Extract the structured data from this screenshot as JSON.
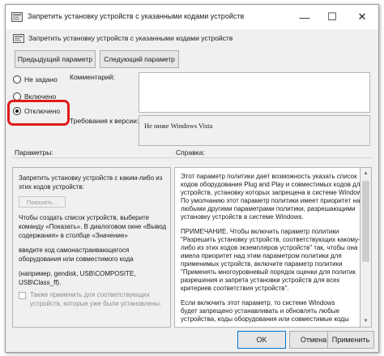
{
  "window": {
    "title": "Запретить установку устройств с указанными кодами устройств",
    "minimize": "—",
    "maximize": "☐",
    "close": "✕"
  },
  "policy": {
    "name": "Запретить установку устройств с указанными кодами устройств"
  },
  "nav": {
    "prev_label": "Предыдущий параметр",
    "next_label": "Следующий параметр"
  },
  "state": {
    "options": [
      {
        "label": "Не задано",
        "checked": false
      },
      {
        "label": "Включено",
        "checked": false
      },
      {
        "label": "Отключено",
        "checked": true
      }
    ],
    "highlight_color": "#e11b1b"
  },
  "labels": {
    "comment": "Комментарий:",
    "supported": "Требования к версии:",
    "params": "Параметры:",
    "help": "Справка:"
  },
  "supported_value": "Не ниже Windows Vista",
  "options_panel": {
    "lines": [
      "Запретить установку устройств с каким-либо из",
      "этих кодов устройств:",
      "Чтобы создать список устройств, выберите",
      "команду «Показать». В диалоговом окне «Вывод",
      "содержания» в столбце «Значение»",
      "введите код самонастраивающегося",
      "оборудования или совместимого кода",
      "(например, gendisk, USB\\COMPOSITE,",
      "USB\\Class_ff).",
      "Также применить для соответствующих",
      "устройств, которые уже были установлены."
    ],
    "show_button": "Показать..."
  },
  "help_panel": {
    "lines": [
      "Этот параметр политики дает возможность указать список",
      "кодов оборудования Plug and Play и совместимых кодов для",
      "устройств, установку которых запрещена в системе Windows.",
      "По умолчанию этот параметр политики имеет приоритет над",
      "любыми другими параметрами политики, разрешающими",
      "установку устройств в системе Windows.",
      "ПРИМЕЧАНИЕ. Чтобы включить параметр политики",
      "\"Разрешить установку устройств, соответствующих какому-",
      "либо из этих кодов экземпляров устройств\" так, чтобы она",
      "имела приоритет над этим параметром политики для",
      "применимых устройств, включите параметр политики",
      "\"Применять многоуровневый порядок оценки для политик",
      "разрешения и запрета установки устройств для всех",
      "критериев соответствия устройств\".",
      "Если включить этот параметр, то системе Windows",
      "будет запрещено устанавливать и обновлять любые",
      "устройства, коды оборудования или совместимые коды"
    ]
  },
  "footer": {
    "ok": "OK",
    "cancel": "Отмена",
    "apply": "Применить"
  }
}
